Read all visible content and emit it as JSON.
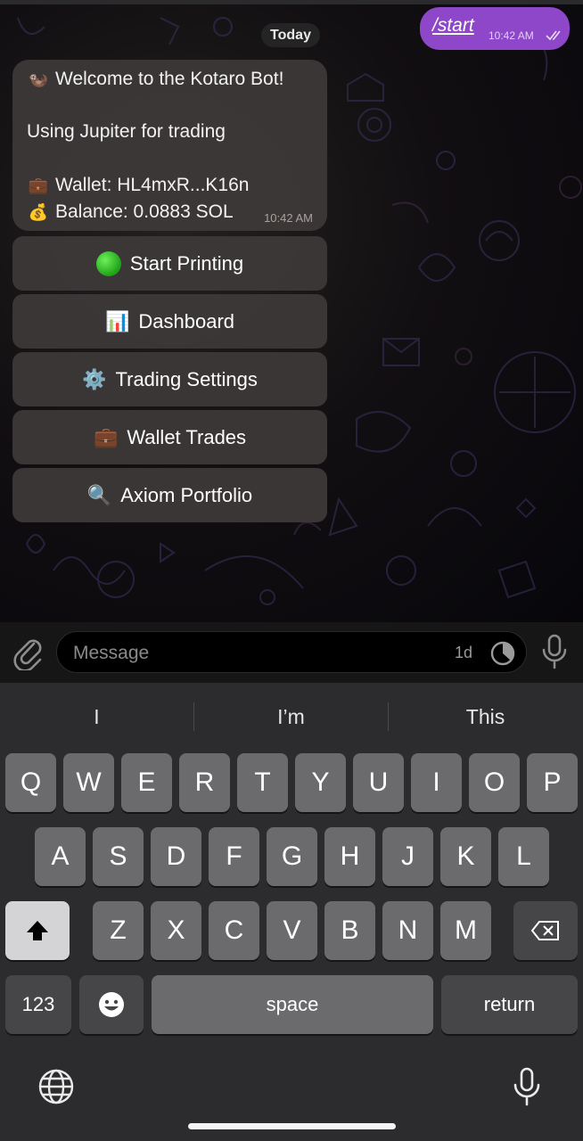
{
  "chat": {
    "date_label": "Today",
    "outgoing": {
      "text": "/start",
      "time": "10:42 AM",
      "status_icon": "double-check-icon"
    },
    "incoming": {
      "title": "Welcome to the Kotaro Bot!",
      "line2": "Using Jupiter for trading",
      "wallet": "Wallet: HL4mxR...K16n",
      "balance": "Balance: 0.0883 SOL",
      "time": "10:42 AM",
      "title_emoji": "🦦",
      "wallet_emoji": "💼",
      "balance_emoji": "💰"
    },
    "buttons": [
      {
        "label": "Start Printing",
        "icon": "green-circle-icon"
      },
      {
        "label": "Dashboard",
        "icon": "📊"
      },
      {
        "label": "Trading Settings",
        "icon": "⚙️"
      },
      {
        "label": "Wallet Trades",
        "icon": "💼"
      },
      {
        "label": "Axiom Portfolio",
        "icon": "🔍"
      }
    ]
  },
  "composer": {
    "placeholder": "Message",
    "timer": "1d"
  },
  "keyboard": {
    "suggestions": [
      "I",
      "I’m",
      "This"
    ],
    "row1": [
      "Q",
      "W",
      "E",
      "R",
      "T",
      "Y",
      "U",
      "I",
      "O",
      "P"
    ],
    "row2": [
      "A",
      "S",
      "D",
      "F",
      "G",
      "H",
      "J",
      "K",
      "L"
    ],
    "row3": [
      "Z",
      "X",
      "C",
      "V",
      "B",
      "N",
      "M"
    ],
    "numbers_label": "123",
    "space_label": "space",
    "return_label": "return"
  }
}
